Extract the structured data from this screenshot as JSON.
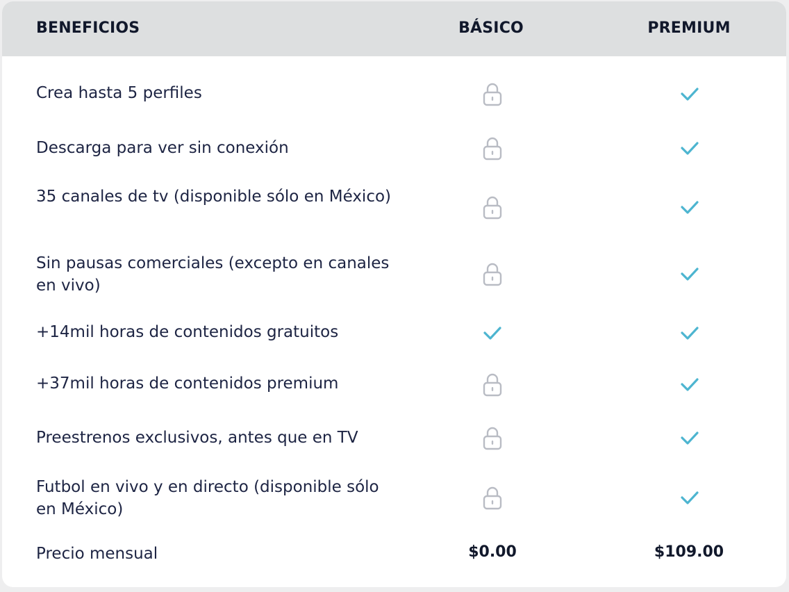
{
  "header": {
    "benefits": "BENEFICIOS",
    "basic": "BÁSICO",
    "premium": "PREMIUM"
  },
  "rows": [
    {
      "label": "Crea hasta 5 perfiles",
      "basic": "lock-icon",
      "premium": "check-icon"
    },
    {
      "label": "Descarga para ver sin conexión",
      "basic": "lock-icon",
      "premium": "check-icon"
    },
    {
      "label": "35 canales de tv (disponible sólo en México)",
      "basic": "lock-icon",
      "premium": "check-icon"
    },
    {
      "label": "Sin pausas comerciales (excepto en canales en vivo)",
      "basic": "lock-icon",
      "premium": "check-icon"
    },
    {
      "label": "+14mil horas de contenidos gratuitos",
      "basic": "check-icon",
      "premium": "check-icon"
    },
    {
      "label": "+37mil horas de contenidos premium",
      "basic": "lock-icon",
      "premium": "check-icon"
    },
    {
      "label": "Preestrenos exclusivos, antes que en TV",
      "basic": "lock-icon",
      "premium": "check-icon"
    },
    {
      "label": "Futbol en vivo y en directo (disponible sólo en México)",
      "basic": "lock-icon",
      "premium": "check-icon"
    }
  ],
  "price": {
    "label": "Precio mensual",
    "basic": "$0.00",
    "premium": "$109.00"
  },
  "colors": {
    "check": "#4db5d0",
    "lock": "#b9bcc4",
    "header_bg": "#dddfe0",
    "text": "#1d2443"
  }
}
